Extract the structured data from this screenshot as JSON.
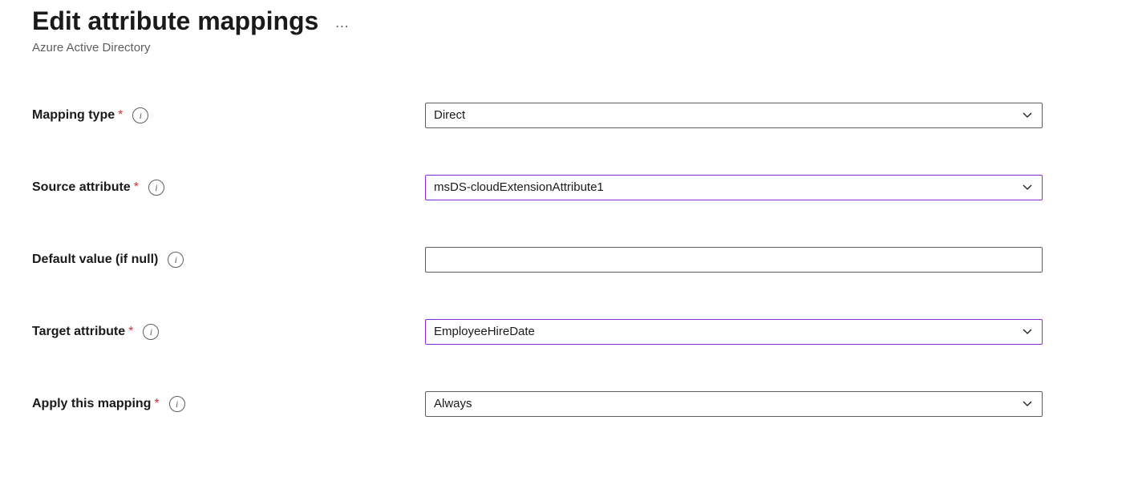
{
  "header": {
    "title": "Edit attribute mappings",
    "subtitle": "Azure Active Directory",
    "more": "…"
  },
  "fields": {
    "mappingType": {
      "label": "Mapping type",
      "required": true,
      "value": "Direct",
      "highlight": false
    },
    "sourceAttr": {
      "label": "Source attribute",
      "required": true,
      "value": "msDS-cloudExtensionAttribute1",
      "highlight": true
    },
    "defaultValue": {
      "label": "Default value (if null)",
      "required": false,
      "value": "",
      "highlight": false
    },
    "targetAttr": {
      "label": "Target attribute",
      "required": true,
      "value": "EmployeeHireDate",
      "highlight": true
    },
    "applyMapping": {
      "label": "Apply this mapping",
      "required": true,
      "value": "Always",
      "highlight": false
    }
  }
}
